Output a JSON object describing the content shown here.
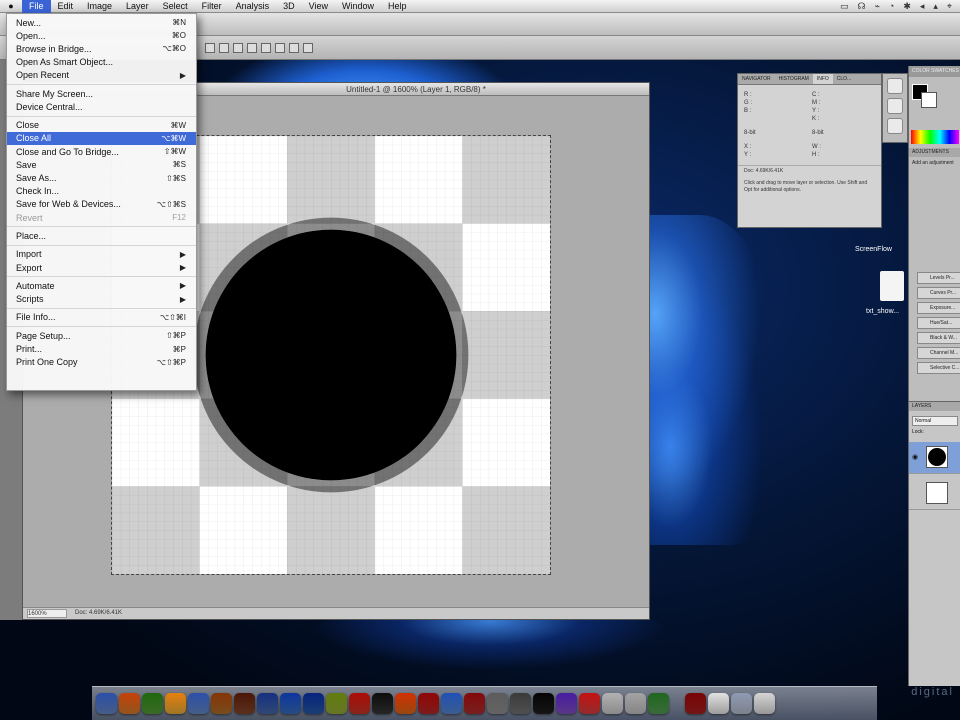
{
  "menubar": {
    "apple": "",
    "items": [
      "File",
      "Edit",
      "Image",
      "Layer",
      "Select",
      "Filter",
      "Analysis",
      "3D",
      "View",
      "Window",
      "Help"
    ],
    "active": "File",
    "tray": [
      "▭",
      "☊",
      "⌁",
      "◔",
      "✱",
      "◂",
      "▴",
      "⌖"
    ]
  },
  "document": {
    "title": "Untitled-1 @ 1600% (Layer 1, RGB/8) *",
    "zoom": "1600%",
    "doc_size": "Doc: 4.69K/6.41K"
  },
  "file_menu": {
    "groups": [
      [
        {
          "label": "New...",
          "shortcut": "⌘N"
        },
        {
          "label": "Open...",
          "shortcut": "⌘O"
        },
        {
          "label": "Browse in Bridge...",
          "shortcut": "⌥⌘O"
        },
        {
          "label": "Open As Smart Object...",
          "shortcut": ""
        },
        {
          "label": "Open Recent",
          "shortcut": "▶"
        }
      ],
      [
        {
          "label": "Share My Screen...",
          "shortcut": ""
        },
        {
          "label": "Device Central...",
          "shortcut": ""
        }
      ],
      [
        {
          "label": "Close",
          "shortcut": "⌘W"
        },
        {
          "label": "Close All",
          "shortcut": "⌥⌘W",
          "highlighted": true
        },
        {
          "label": "Close and Go To Bridge...",
          "shortcut": "⇧⌘W"
        },
        {
          "label": "Save",
          "shortcut": "⌘S"
        },
        {
          "label": "Save As...",
          "shortcut": "⇧⌘S"
        },
        {
          "label": "Check In...",
          "shortcut": ""
        },
        {
          "label": "Save for Web & Devices...",
          "shortcut": "⌥⇧⌘S"
        },
        {
          "label": "Revert",
          "shortcut": "F12",
          "disabled": true
        }
      ],
      [
        {
          "label": "Place...",
          "shortcut": ""
        }
      ],
      [
        {
          "label": "Import",
          "shortcut": "▶"
        },
        {
          "label": "Export",
          "shortcut": "▶"
        }
      ],
      [
        {
          "label": "Automate",
          "shortcut": "▶"
        },
        {
          "label": "Scripts",
          "shortcut": "▶"
        }
      ],
      [
        {
          "label": "File Info...",
          "shortcut": "⌥⇧⌘I"
        }
      ],
      [
        {
          "label": "Page Setup...",
          "shortcut": "⇧⌘P"
        },
        {
          "label": "Print...",
          "shortcut": "⌘P"
        },
        {
          "label": "Print One Copy",
          "shortcut": "⌥⇧⌘P"
        }
      ]
    ]
  },
  "info_panel": {
    "tabs": [
      "NAVIGATOR",
      "HISTOGRAM",
      "INFO",
      "CLO..."
    ],
    "active_tab": "INFO",
    "cells": [
      "R :\nG :\nB :",
      "C :\nM :\nY :\nK :",
      "8-bit",
      "8-bit",
      "X :\nY :",
      "W :\nH :"
    ],
    "doc": "Doc: 4.69K/6.41K",
    "hint": "Click and drag to move layer or selection. Use Shift and Opt for additional options."
  },
  "dock_panel": {
    "tabs": "COLOR SWATCHES",
    "adjustments": "ADJUSTMENTS",
    "add_adjustment": "Add an adjustment",
    "presets": [
      "Levels Pr...",
      "Curves Pr...",
      "Exposure...",
      "Hue/Sat...",
      "Black & W...",
      "Channel M...",
      "Selective C..."
    ],
    "layers_tab": "LAYERS",
    "blend": "Normal",
    "lock": "Lock:"
  },
  "desktop": {
    "icons": [
      "ScreenFlow",
      "txt_show..."
    ],
    "watermark": "digital"
  },
  "colors": {
    "menu_highlight": "#3f6ad8",
    "checker_light": "#ffffff",
    "checker_dark": "#cfcfcf",
    "pixel_circle": "#000000"
  },
  "dock_icons": [
    "#6a8ecf",
    "#e0822f",
    "#5aa33b",
    "#f2b53a",
    "#6b8fd0",
    "#b8742a",
    "#8a4b2c",
    "#4a6fb5",
    "#3b75c9",
    "#2a5fb3",
    "#9db33b",
    "#d13a2a",
    "#3a3a3a",
    "#e86f1a",
    "#c02a2a",
    "#5b8fd8",
    "#b83030",
    "#999999",
    "#7a7a7a",
    "#222222",
    "#8855cc",
    "#e04444",
    "#d5d5d5",
    "#cccccc",
    "#5aa35a",
    "#b02222",
    "#f0f0f0",
    "#bfc7d6",
    "#e9e9e9"
  ]
}
